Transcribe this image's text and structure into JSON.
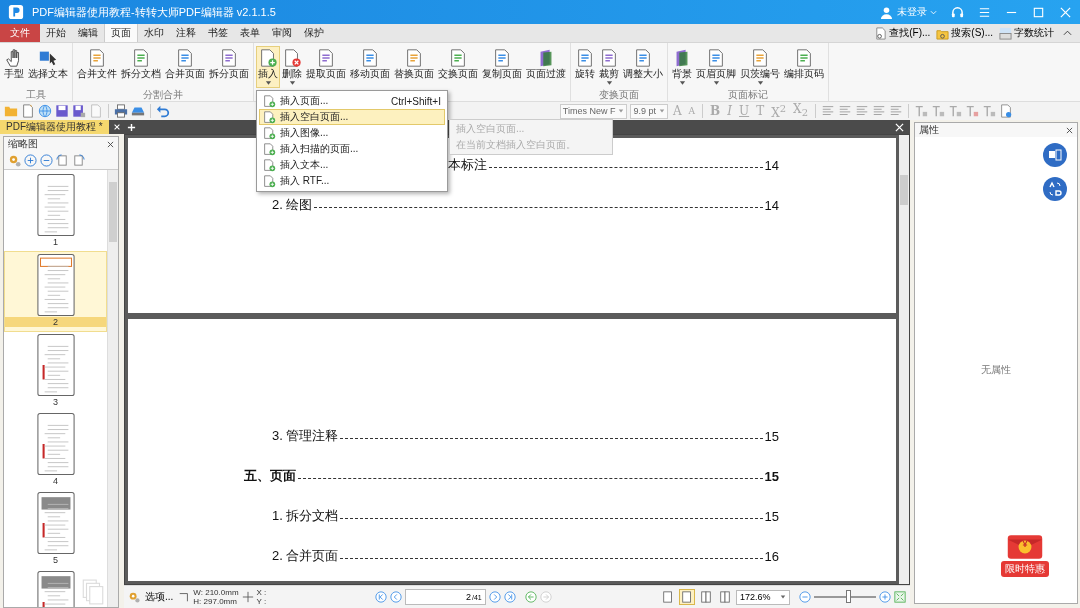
{
  "window": {
    "title": "PDF编辑器使用教程-转转大师PDF编辑器 v2.1.1.5",
    "user": "未登录"
  },
  "menu_tabs": [
    {
      "label": "文件",
      "kind": "file",
      "selected": false
    },
    {
      "label": "开始",
      "kind": "tab",
      "selected": false
    },
    {
      "label": "编辑",
      "kind": "tab",
      "selected": false
    },
    {
      "label": "页面",
      "kind": "tab",
      "selected": true
    },
    {
      "label": "水印",
      "kind": "tab",
      "selected": false
    },
    {
      "label": "注释",
      "kind": "tab",
      "selected": false
    },
    {
      "label": "书签",
      "kind": "tab",
      "selected": false
    },
    {
      "label": "表单",
      "kind": "tab",
      "selected": false
    },
    {
      "label": "审阅",
      "kind": "tab",
      "selected": false
    },
    {
      "label": "保护",
      "kind": "tab",
      "selected": false
    }
  ],
  "quick_tools": [
    {
      "label": "查找(F)...",
      "kind": "find"
    },
    {
      "label": "搜索(S)...",
      "kind": "search"
    },
    {
      "label": "字数统计",
      "kind": "count"
    }
  ],
  "ribbon": [
    {
      "group": "工具",
      "buttons": [
        {
          "label": "手型",
          "kind": "hand",
          "dropdown": false,
          "open": false
        },
        {
          "label": "选择文本",
          "kind": "select",
          "dropdown": false,
          "open": false
        }
      ]
    },
    {
      "group": "分割合并",
      "buttons": [
        {
          "label": "合并文件",
          "kind": "page",
          "dropdown": false,
          "open": false
        },
        {
          "label": "拆分文档",
          "kind": "page",
          "dropdown": false,
          "open": false
        },
        {
          "label": "合并页面",
          "kind": "page",
          "dropdown": false,
          "open": false
        },
        {
          "label": "拆分页面",
          "kind": "page",
          "dropdown": false,
          "open": false
        }
      ]
    },
    {
      "buttons": [
        {
          "label": "插入",
          "kind": "add",
          "dropdown": true,
          "open": true
        },
        {
          "label": "删除",
          "kind": "delete",
          "dropdown": true,
          "open": false
        },
        {
          "label": "提取页面",
          "kind": "page",
          "dropdown": false,
          "open": false
        },
        {
          "label": "移动页面",
          "kind": "page",
          "dropdown": false,
          "open": false
        },
        {
          "label": "替换页面",
          "kind": "page",
          "dropdown": false,
          "open": false
        },
        {
          "label": "交换页面",
          "kind": "page",
          "dropdown": false,
          "open": false
        },
        {
          "label": "复制页面",
          "kind": "page",
          "dropdown": false,
          "open": false
        },
        {
          "label": "页面过渡",
          "kind": "book",
          "dropdown": false,
          "open": false
        }
      ]
    },
    {
      "group": "变换页面",
      "buttons": [
        {
          "label": "旋转",
          "kind": "page",
          "dropdown": false,
          "open": false
        },
        {
          "label": "裁剪",
          "kind": "page",
          "dropdown": true,
          "open": false
        },
        {
          "label": "调整大小",
          "kind": "page",
          "dropdown": false,
          "open": false
        }
      ]
    },
    {
      "group": "页面标记",
      "buttons": [
        {
          "label": "背景",
          "kind": "book",
          "dropdown": true,
          "open": false
        },
        {
          "label": "页眉页脚",
          "kind": "page",
          "dropdown": true,
          "open": false
        },
        {
          "label": "贝茨编号",
          "kind": "page",
          "dropdown": true,
          "open": false
        },
        {
          "label": "编排页码",
          "kind": "page",
          "dropdown": false,
          "open": false
        }
      ]
    }
  ],
  "insert_menu": [
    {
      "label": "插入页面...",
      "shortcut": "Ctrl+Shift+I",
      "selected": false
    },
    {
      "label": "插入空白页面...",
      "selected": true
    },
    {
      "label": "插入图像...",
      "selected": false
    },
    {
      "label": "插入扫描的页面...",
      "selected": false
    },
    {
      "label": "插入文本...",
      "selected": false
    },
    {
      "label": "插入 RTF...",
      "selected": false
    }
  ],
  "tooltip": {
    "title": "插入空白页面...",
    "text": "在当前文档插入空白页面。"
  },
  "toolbar": {
    "font": "Times New F",
    "size": "9.9 pt",
    "size_buttons": [
      "A",
      "A"
    ],
    "format_buttons": [
      "B",
      "I",
      "U",
      "T",
      "X$^{2}$",
      "X$_{2}$"
    ]
  },
  "document_tab": {
    "label": "PDF编辑器使用教程 *"
  },
  "thumbnails": {
    "title": "缩略图",
    "pages": [
      {
        "label": "1",
        "selected": false
      },
      {
        "label": "2",
        "selected": true
      },
      {
        "label": "3",
        "selected": false
      },
      {
        "label": "4",
        "selected": false
      },
      {
        "label": "5",
        "selected": false
      },
      {
        "selected": false
      }
    ]
  },
  "document": {
    "pages": [
      {
        "entries": [
          {
            "kind": "continued",
            "text": "本标注",
            "page": "14"
          },
          {
            "kind": "item",
            "text": "2. 绘图",
            "page": "14"
          }
        ]
      },
      {
        "entries": [
          {
            "kind": "item",
            "text": "3. 管理注释",
            "page": "15"
          },
          {
            "kind": "section",
            "text": "五、页面",
            "page": "15"
          },
          {
            "kind": "item",
            "text": "1. 拆分文档",
            "page": "15"
          },
          {
            "kind": "item",
            "text": "2. 合并页面",
            "page": "16"
          }
        ]
      }
    ]
  },
  "status_bar": {
    "options": "选项...",
    "width": "W: 210.0mm",
    "height": "H: 297.0mm",
    "x": "X :",
    "y": "Y :",
    "page": "2",
    "page_count": "/41",
    "zoom": "172.6%",
    "zoom_slider": {
      "level": 0.55
    },
    "view_modes": [
      {
        "selected": false
      },
      {
        "selected": true
      },
      {
        "selected": false
      },
      {
        "selected": false
      }
    ]
  },
  "properties": {
    "title": "属性",
    "empty": "无属性"
  },
  "promo": {
    "amount": "¥",
    "label": "限时特惠"
  }
}
